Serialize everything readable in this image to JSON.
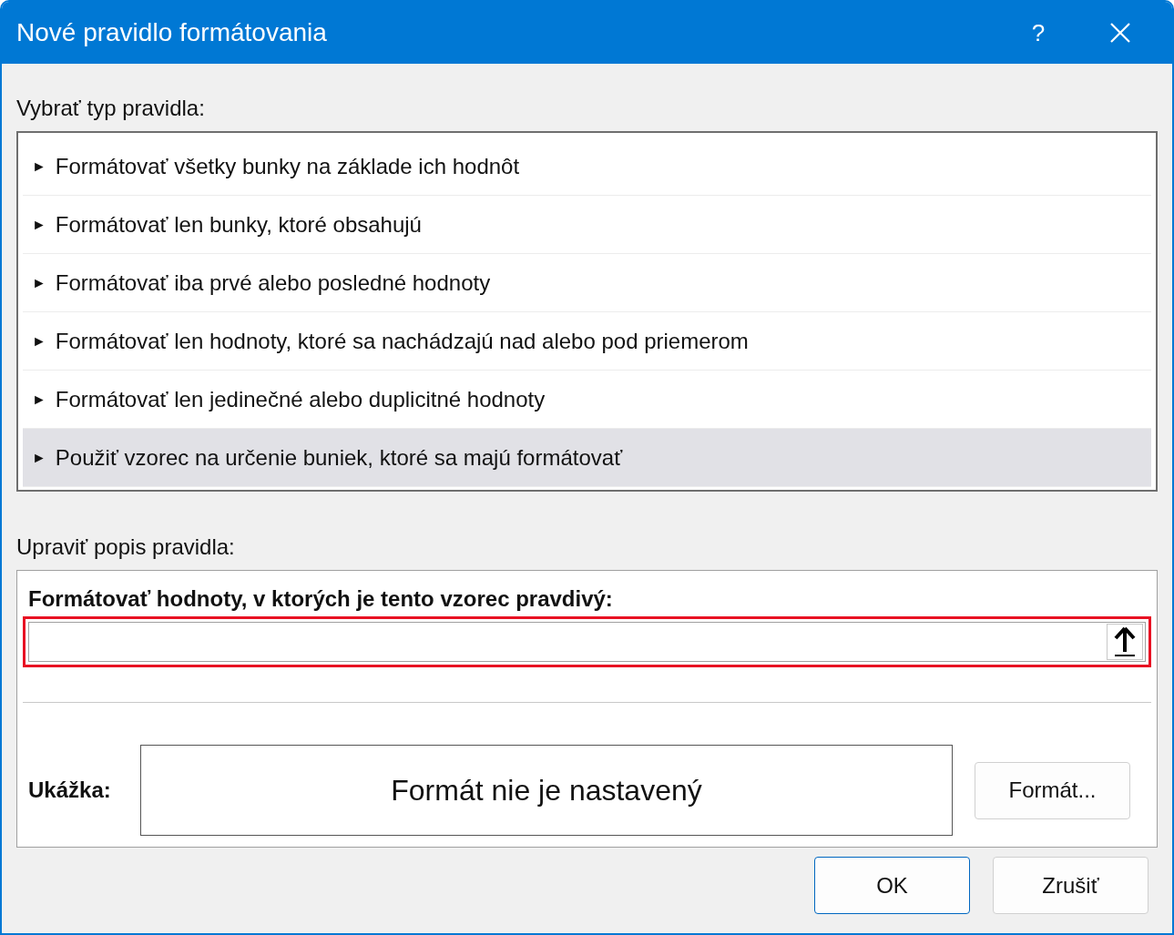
{
  "window": {
    "title": "Nové pravidlo formátovania",
    "help": "?"
  },
  "rule_type": {
    "label": "Vybrať typ pravidla:",
    "items": [
      {
        "marker": "►",
        "label": "Formátovať všetky bunky na základe ich hodnôt",
        "selected": false
      },
      {
        "marker": "►",
        "label": "Formátovať len bunky, ktoré obsahujú",
        "selected": false
      },
      {
        "marker": "►",
        "label": "Formátovať iba prvé alebo posledné hodnoty",
        "selected": false
      },
      {
        "marker": "►",
        "label": "Formátovať len hodnoty, ktoré sa nachádzajú nad alebo pod priemerom",
        "selected": false
      },
      {
        "marker": "►",
        "label": "Formátovať len jedinečné alebo duplicitné hodnoty",
        "selected": false
      },
      {
        "marker": "►",
        "label": "Použiť vzorec na určenie buniek, ktoré sa majú formátovať",
        "selected": true
      }
    ]
  },
  "description": {
    "label": "Upraviť popis pravidla:",
    "formula_label": "Formátovať hodnoty, v ktorých je tento vzorec pravdivý:",
    "formula_highlighted": true,
    "preview_label": "Ukážka:",
    "preview_text": "Formát nie je nastavený",
    "format_button": "Formát..."
  },
  "buttons": [
    "OK",
    "Zrušiť"
  ]
}
